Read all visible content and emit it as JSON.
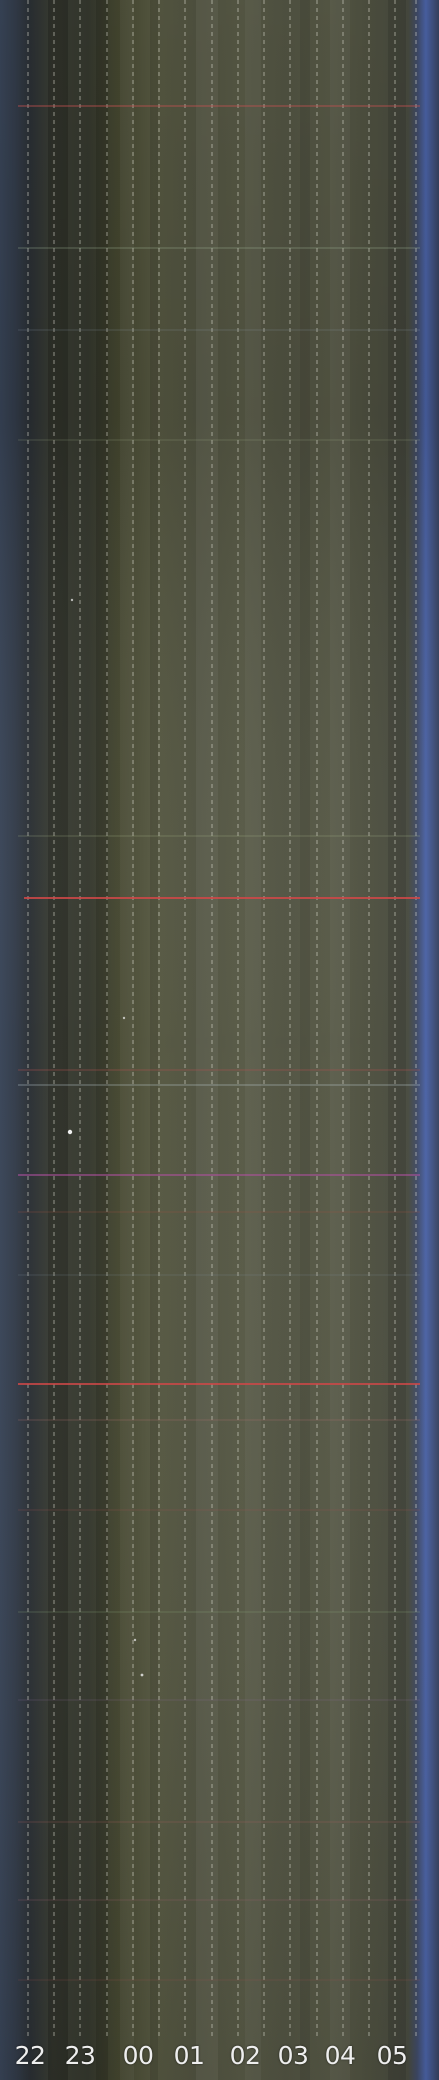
{
  "keogram": {
    "time_labels": [
      "22",
      "23",
      "00",
      "01",
      "02",
      "03",
      "04",
      "05"
    ]
  },
  "colors": {
    "left_edge": "#3a465a",
    "body_olive": "#4f5140",
    "dark_band": "#2a2d24",
    "right_edge_blue": "#4b63a8",
    "label_text": "#eeeeee",
    "red_streak": "#c04040",
    "pink_streak": "#b0508a"
  }
}
